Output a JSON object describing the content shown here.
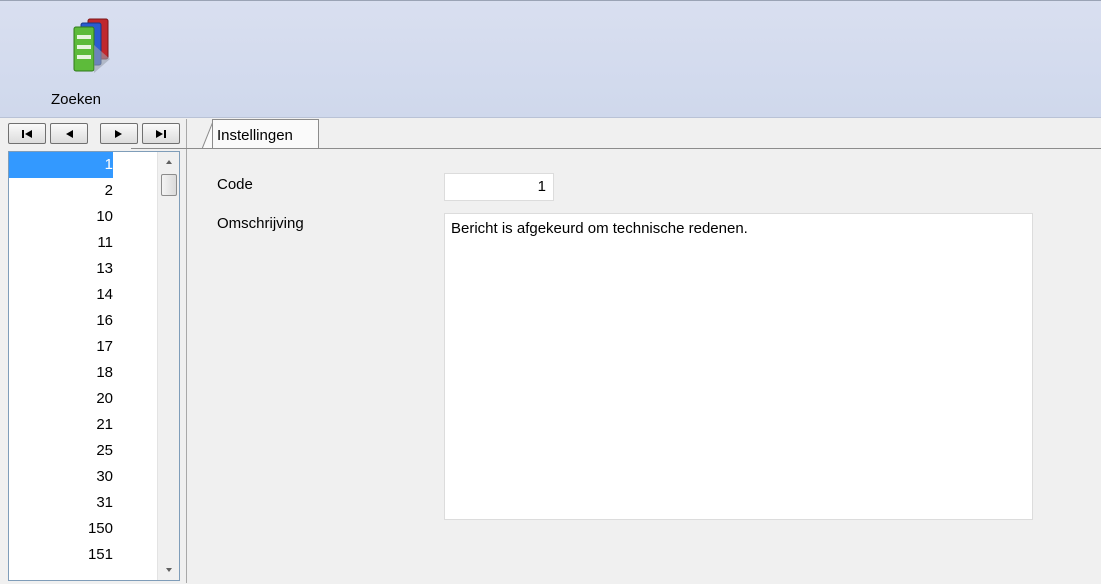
{
  "toolbar": {
    "zoeken_label": "Zoeken",
    "zoeken_icon": "binders-search-icon"
  },
  "navigator": {
    "first_icon": "first-record-icon",
    "prev_icon": "previous-record-icon",
    "next_icon": "next-record-icon",
    "last_icon": "last-record-icon"
  },
  "record_list": {
    "selected": "1",
    "items": [
      "1",
      "2",
      "10",
      "11",
      "13",
      "14",
      "16",
      "17",
      "18",
      "20",
      "21",
      "25",
      "30",
      "31",
      "150",
      "151"
    ]
  },
  "tabs": [
    {
      "label": "Instellingen",
      "active": true
    }
  ],
  "form": {
    "code_label": "Code",
    "code_value": "1",
    "omschrijving_label": "Omschrijving",
    "omschrijving_value": "Bericht is afgekeurd om technische redenen."
  },
  "colors": {
    "ribbon": "#d4dcef",
    "selection": "#3399ff",
    "panel": "#f0f0f0"
  }
}
